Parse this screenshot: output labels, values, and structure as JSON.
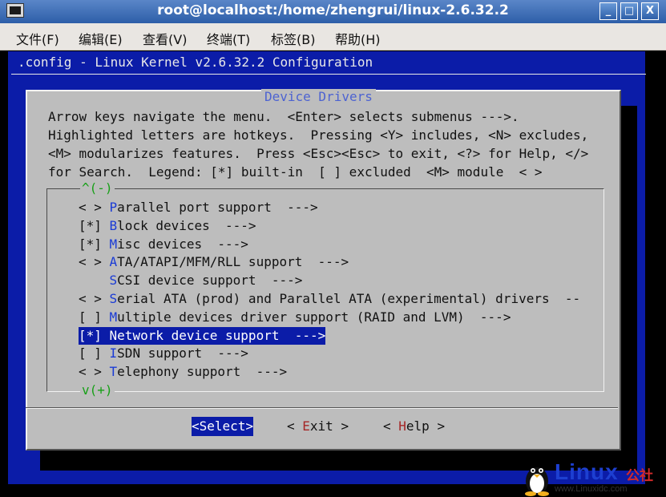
{
  "window": {
    "title": "root@localhost:/home/zhengrui/linux-2.6.32.2",
    "minimize": "_",
    "maximize": "□",
    "close": "X"
  },
  "menubar": [
    "文件(F)",
    "编辑(E)",
    "查看(V)",
    "终端(T)",
    "标签(B)",
    "帮助(H)"
  ],
  "config_title": ".config - Linux Kernel v2.6.32.2 Configuration",
  "dialog": {
    "title": "Device Drivers",
    "help": [
      "Arrow keys navigate the menu.  <Enter> selects submenus --->.",
      "Highlighted letters are hotkeys.  Pressing <Y> includes, <N> excludes,",
      "<M> modularizes features.  Press <Esc><Esc> to exit, <?> for Help, </>",
      "for Search.  Legend: [*] built-in  [ ] excluded  <M> module  < >"
    ],
    "scroll_up": "^(-)",
    "scroll_down": "v(+)",
    "items": [
      {
        "prefix": "< > ",
        "hotkey": "P",
        "rest": "arallel port support  --->"
      },
      {
        "prefix": "[*] ",
        "hotkey": "B",
        "rest": "lock devices  --->"
      },
      {
        "prefix": "[*] ",
        "hotkey": "M",
        "rest": "isc devices  --->"
      },
      {
        "prefix": "< > ",
        "hotkey": "A",
        "rest": "TA/ATAPI/MFM/RLL support  --->"
      },
      {
        "prefix": "    ",
        "hotkey": "S",
        "rest": "CSI device support  --->"
      },
      {
        "prefix": "< > ",
        "hotkey": "S",
        "rest": "erial ATA (prod) and Parallel ATA (experimental) drivers  --"
      },
      {
        "prefix": "[ ] ",
        "hotkey": "M",
        "rest": "ultiple devices driver support (RAID and LVM)  --->"
      },
      {
        "prefix": "[*] ",
        "hotkey": "N",
        "rest": "etwork device support  --->"
      },
      {
        "prefix": "[ ] ",
        "hotkey": "I",
        "rest": "SDN support  --->"
      },
      {
        "prefix": "< > ",
        "hotkey": "T",
        "rest": "elephony support  --->"
      }
    ],
    "selected_index": 7,
    "buttons": {
      "select": {
        "open": "<",
        "hot": "S",
        "rest": "elect",
        "close": ">"
      },
      "exit": {
        "open": "< ",
        "hot": "E",
        "rest": "xit",
        "close": " >"
      },
      "help": {
        "open": "< ",
        "hot": "H",
        "rest": "elp",
        "close": " >"
      }
    }
  },
  "watermark": {
    "brand": "Linux",
    "cn": "公社",
    "url": "www.Linuxidc.com"
  },
  "colors": {
    "title_blue": "#2d5ea8",
    "terminal_blue": "#0b1ca8",
    "dialog_gray": "#bdbdbd",
    "hotkey_blue": "#1a3bd6",
    "hotkey_red": "#a52626",
    "marker_green": "#18a018"
  }
}
